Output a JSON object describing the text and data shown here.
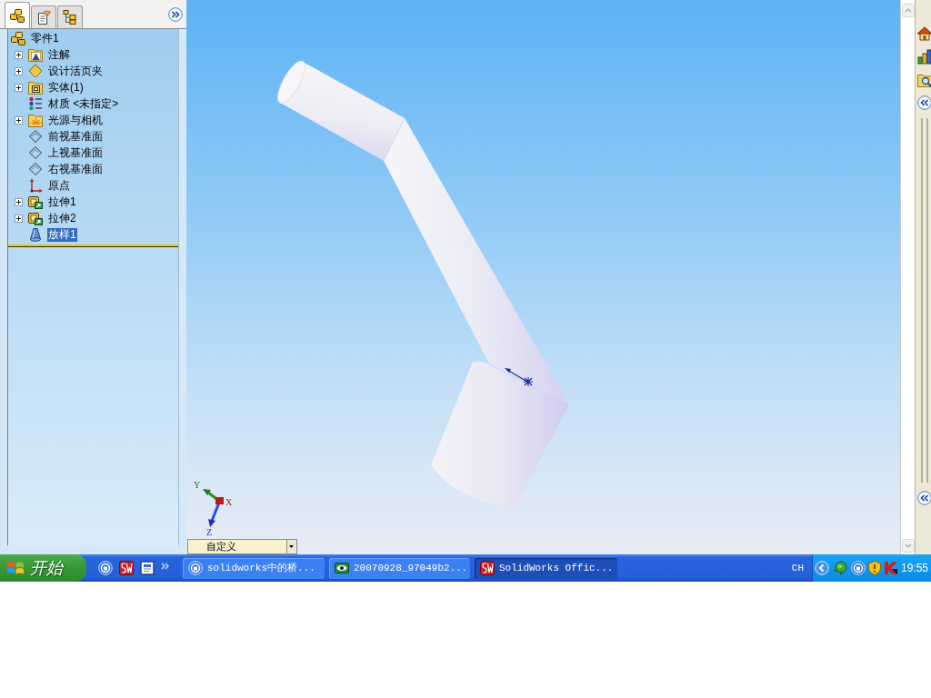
{
  "panel": {
    "tabs": [
      {
        "kind": "feature-tree",
        "selected": true
      },
      {
        "kind": "properties",
        "selected": false
      },
      {
        "kind": "configurations",
        "selected": false
      }
    ],
    "tree": {
      "label": "零件1",
      "kind": "part",
      "selected": false,
      "children": [
        {
          "label": "注解",
          "kind": "annotations",
          "expandable": true,
          "selected": false
        },
        {
          "label": "设计活页夹",
          "kind": "design-binder",
          "expandable": true,
          "selected": false
        },
        {
          "label": "实体(1)",
          "kind": "solid-bodies",
          "expandable": true,
          "selected": false
        },
        {
          "label": "材质 <未指定>",
          "kind": "material",
          "expandable": false,
          "selected": false
        },
        {
          "label": "光源与相机",
          "kind": "lights-cameras",
          "expandable": true,
          "selected": false
        },
        {
          "label": "前视基准面",
          "kind": "plane",
          "expandable": false,
          "selected": false
        },
        {
          "label": "上视基准面",
          "kind": "plane",
          "expandable": false,
          "selected": false
        },
        {
          "label": "右视基准面",
          "kind": "plane",
          "expandable": false,
          "selected": false
        },
        {
          "label": "原点",
          "kind": "origin",
          "expandable": false,
          "selected": false
        },
        {
          "label": "拉伸1",
          "kind": "extrude",
          "expandable": true,
          "selected": false
        },
        {
          "label": "拉伸2",
          "kind": "extrude",
          "expandable": true,
          "selected": false
        },
        {
          "label": "放样1",
          "kind": "loft",
          "expandable": false,
          "selected": true
        }
      ]
    }
  },
  "viewport": {
    "triad_labels": [
      "Y",
      "X",
      "Z"
    ],
    "view_selector": {
      "value": "自定义"
    }
  },
  "taskbar": {
    "start_label": "开始",
    "tasks": [
      {
        "label": "solidworks中的桥...",
        "kind": "browser",
        "selected": false
      },
      {
        "label": "20070928_97049b2...",
        "kind": "image-viewer",
        "selected": false
      },
      {
        "label": "SolidWorks Offic...",
        "kind": "cad",
        "selected": true
      }
    ],
    "language": "CH",
    "time": "19:55"
  }
}
